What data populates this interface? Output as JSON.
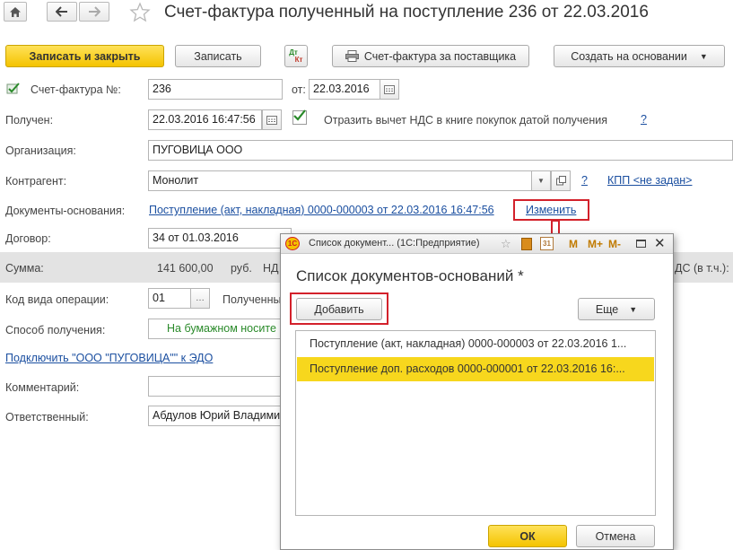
{
  "nav": {
    "home_icon": "home-icon",
    "back_icon": "arrow-left-icon",
    "forward_icon": "arrow-right-icon",
    "star_icon": "star-icon"
  },
  "title": "Счет-фактура полученный на поступление 236 от 22.03.2016",
  "toolbar": {
    "save_close": "Записать и закрыть",
    "save": "Записать",
    "dt_kt_top": "Дт",
    "dt_kt_bottom": "Кт",
    "supplier_invoice": "Счет-фактура за поставщика",
    "create_based": "Создать на основании"
  },
  "form": {
    "invoice_label": "Счет-фактура №:",
    "invoice_number": "236",
    "date_from_label": "от:",
    "invoice_date": "22.03.2016",
    "received_label": "Получен:",
    "received_value": "22.03.2016 16:47:56",
    "vat_checkbox_label": "Отразить вычет НДС в книге покупок датой получения",
    "help": "?",
    "org_label": "Организация:",
    "org_value": "ПУГОВИЦА ООО",
    "contractor_label": "Контрагент:",
    "contractor_value": "Монолит",
    "kpp_link": "КПП <не задан>",
    "docs_label": "Документы-основания:",
    "docs_link": "Поступление (акт, накладная) 0000-000003 от 22.03.2016 16:47:56",
    "change_link": "Изменить",
    "contract_label": "Договор:",
    "contract_value": "34 от 01.03.2016",
    "sum_label": "Сумма:",
    "sum_value": "141 600,00",
    "currency": "руб.",
    "nds_partial": "НД",
    "nds_right": "ДС (в т.ч.):",
    "op_code_label": "Код вида операции:",
    "op_code_value": "01",
    "received_partial": "Полученны",
    "method_label": "Способ получения:",
    "method_value": "На бумажном носите",
    "edo_link": "Подключить \"ООО \"ПУГОВИЦА\"\" к ЭДО",
    "comment_label": "Комментарий:",
    "responsible_label": "Ответственный:",
    "responsible_value": "Абдулов Юрий Владими"
  },
  "dialog": {
    "window_title": "Список документ... (1С:Предприятие)",
    "header": "Список документов-оснований *",
    "add": "Добавить",
    "more": "Еще",
    "rows": [
      "Поступление (акт, накладная) 0000-000003 от 22.03.2016 1...",
      "Поступление доп. расходов 0000-000001 от 22.03.2016 16:..."
    ],
    "ok": "ОК",
    "cancel": "Отмена",
    "tb_m": "M",
    "tb_mplus": "M+",
    "tb_mminus": "M-",
    "calendar_day": "31"
  },
  "colors": {
    "accent_yellow": "#f4c300",
    "selection": "#f7d71d",
    "highlight_red": "#d3212b",
    "link": "#1b4fa0"
  }
}
